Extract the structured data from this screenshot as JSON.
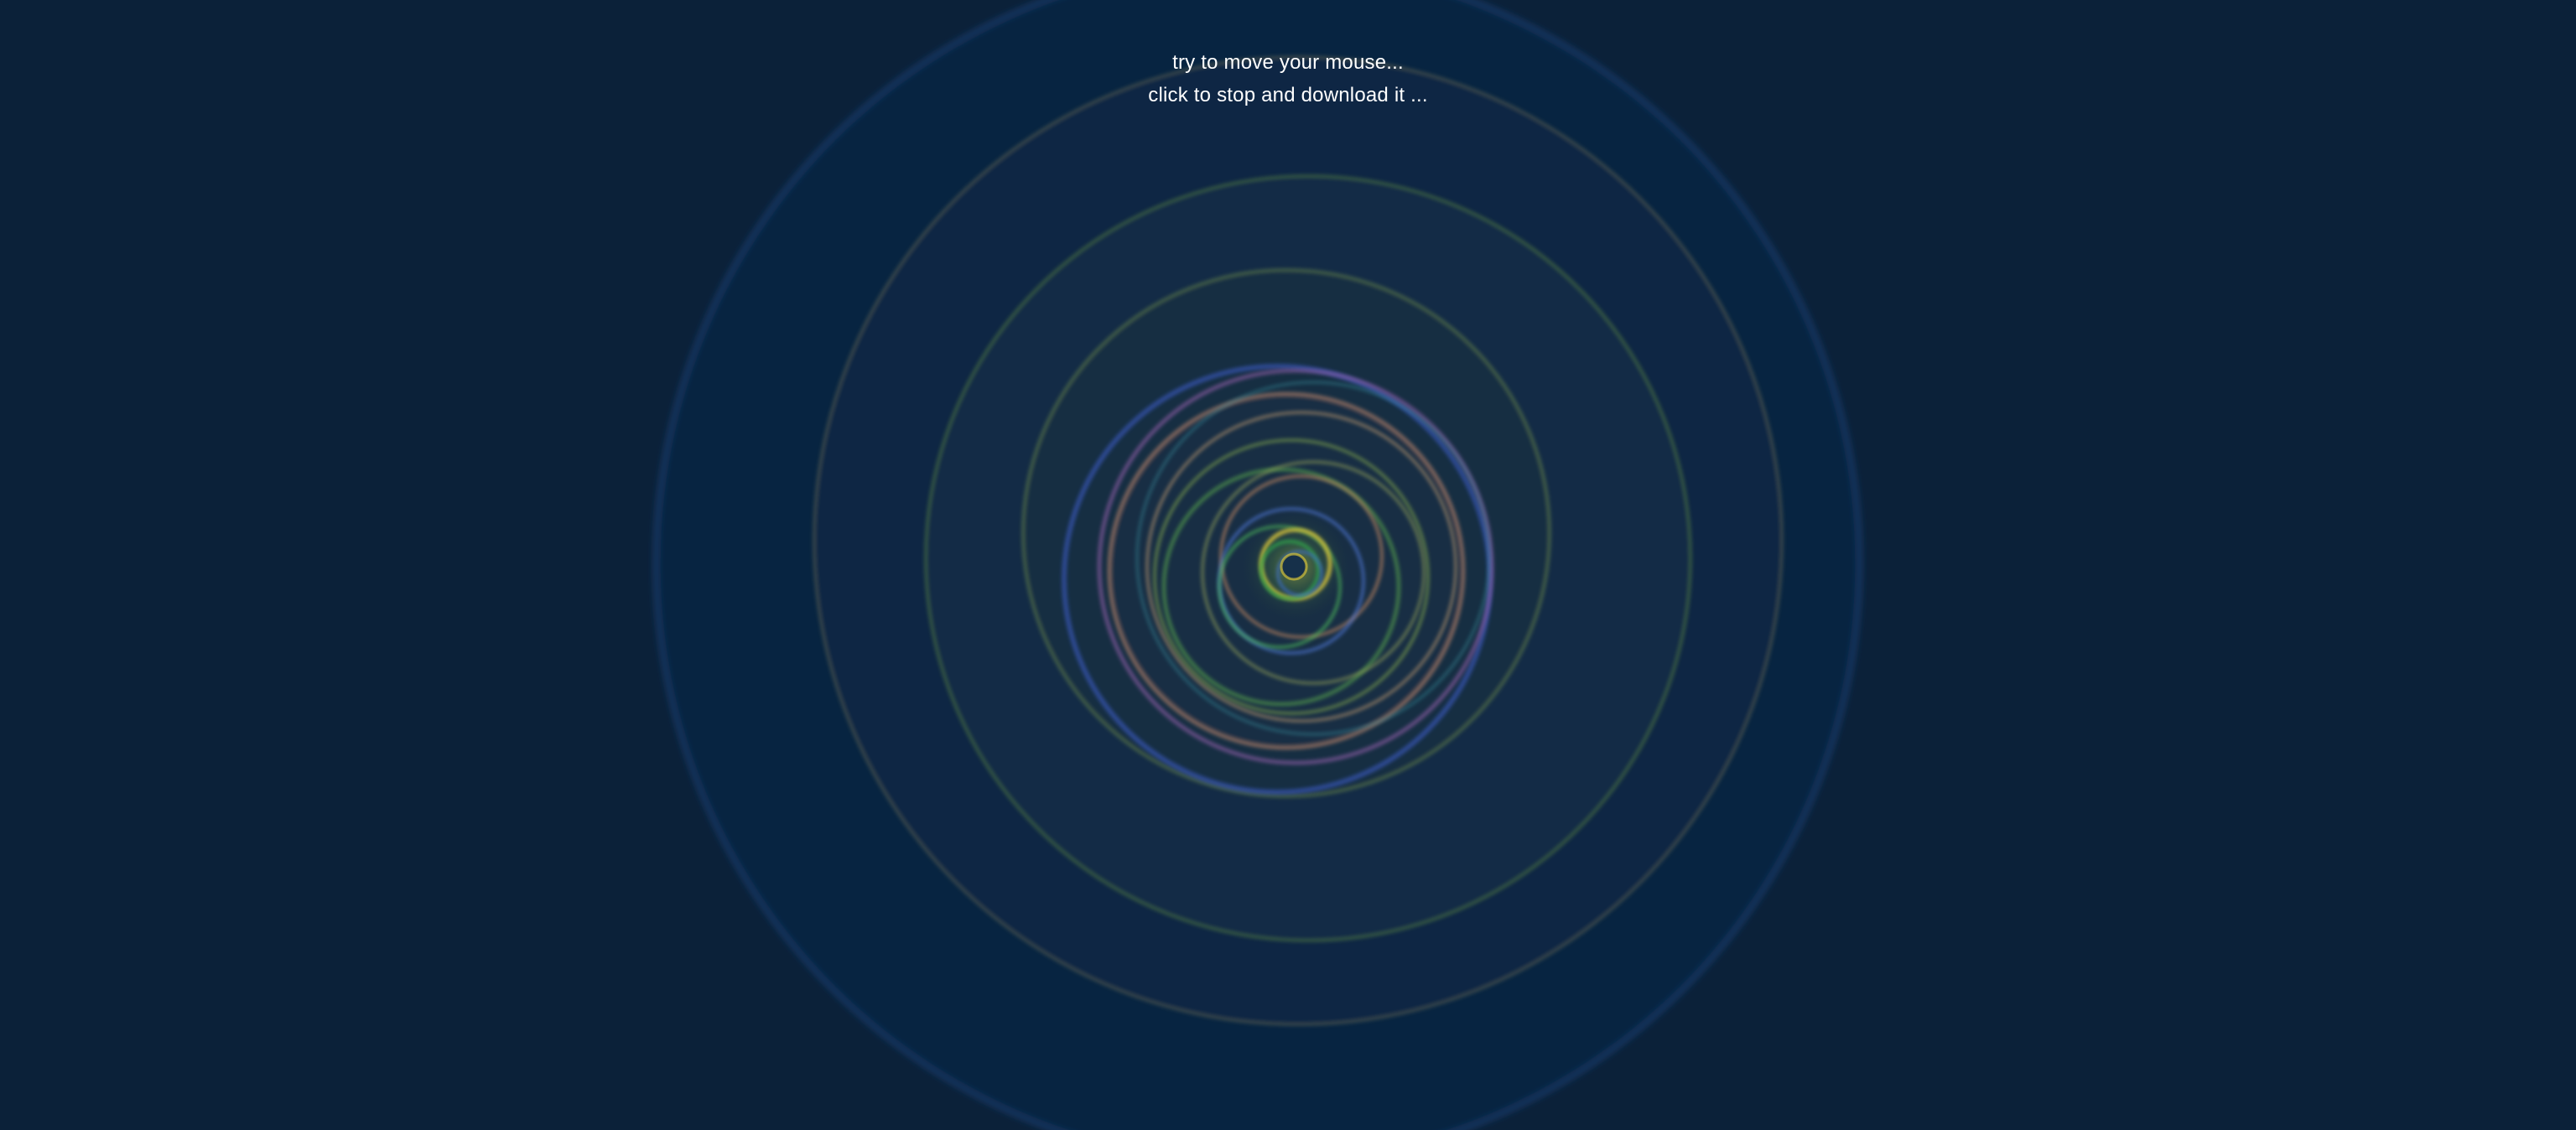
{
  "background_color": "#0b2139",
  "instructions": {
    "line1": "try to move your mouse...",
    "line2": "click to stop and download it ..."
  },
  "ring_palette": [
    "#2a5fb0",
    "#6b6a55",
    "#5d8a3e",
    "#b06aa0",
    "#c98b70",
    "#3f6fd0",
    "#7fb34a",
    "#9ec45a",
    "#d4c23a",
    "#2fa64a"
  ]
}
